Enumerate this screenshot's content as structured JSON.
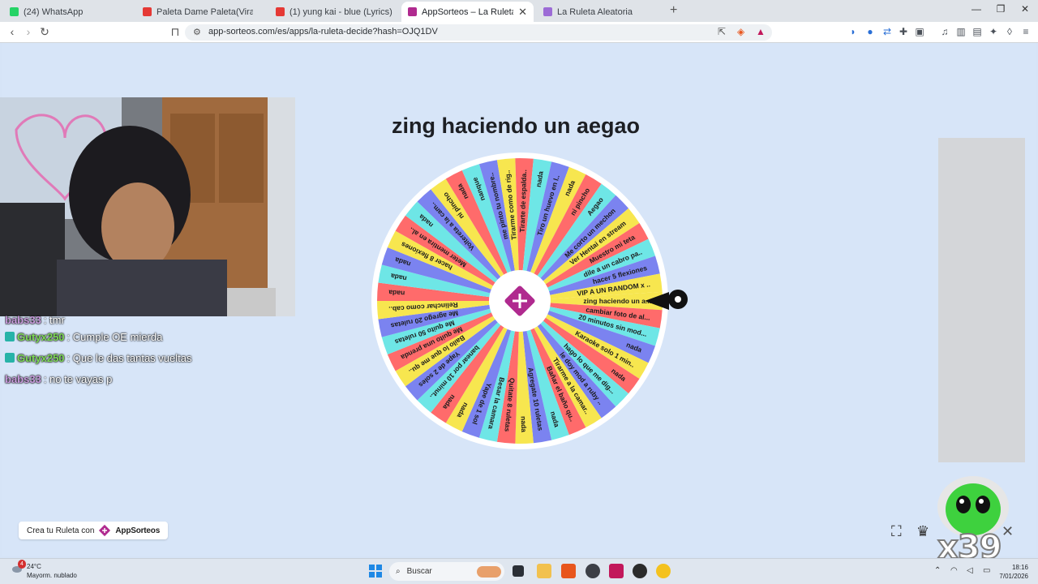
{
  "tabs": [
    {
      "title": "(24) WhatsApp",
      "fav_color": "#25d366"
    },
    {
      "title": "Paleta Dame Paleta(Viral TikTok)",
      "fav_color": "#e53935"
    },
    {
      "title": "(1) yung kai - blue (Lyrics) - YouTube",
      "fav_color": "#e53935"
    },
    {
      "title": "AppSorteos – La Ruleta de la Su",
      "fav_color": "#b02a8f",
      "close": "✕"
    },
    {
      "title": "La Ruleta Aleatoria",
      "fav_color": "#9c6bd6"
    }
  ],
  "new_tab": "+",
  "window_controls": [
    "—",
    "❐",
    "✕"
  ],
  "address": {
    "url": "app-sorteos.com/es/apps/la-ruleta-decide?hash=OJQ1DV"
  },
  "wheel": {
    "title": "zing haciendo un aegao",
    "segment_colors": [
      "#f7e64f",
      "#ff6b6b",
      "#6ee6e6",
      "#7b83f0",
      "#f7e64f",
      "#ff6b6b",
      "#6ee6e6",
      "#7b83f0"
    ],
    "segments": [
      "zing haciendo un a...",
      "cambiar foto de al...",
      "20 minutos sin mod...",
      "nada",
      "Karaoke solo 1 min..",
      "nada",
      "hago lo que me dig...",
      "le doy mod a ruby ..",
      "Tirarme a la camar..",
      "Bañar el baño qu..",
      "nada",
      "Agregate 10 ruletas",
      "nada",
      "Quitate 8 ruletas",
      "Besar la camara",
      "Yape de 1 sol",
      "nada",
      "nada",
      "banear por 10 minut..",
      "Yape de 2 soles",
      "Bailo lo que me qu..",
      "Me quito una prenda",
      "Me quito 50 ruletas",
      "Me agrego 20 ruletas",
      "Relinchar como cab..",
      "nada",
      "nada",
      "nada",
      "hacer 8 flexiones",
      "Meter mentira en al..",
      "nada",
      "Voltereta a la cam..",
      "ni pincho",
      "nada",
      "nanque",
      "me pinto tu nombre..",
      "Tirarme como de rig..",
      "Tirarte de espalda..",
      "nada",
      "Tiro un huevo en l..",
      "nada",
      "ni pincho",
      "Aegao",
      "Me corto un mechon",
      "Ver Hentai en stream",
      "Muestro mi teta",
      "dile a un cabro pa..",
      "hacer 5 flexiones",
      "VIP A UN RANDOM x .."
    ]
  },
  "crea": {
    "label": "Crea tu Ruleta con",
    "brand": "AppSorteos"
  },
  "chat": [
    {
      "user": "babs33",
      "msg": ": tmr",
      "color": "#c89bdc"
    },
    {
      "user": "Gutyx250",
      "msg": ": Cumple OE mierda",
      "color": "#7ed957",
      "badge": true
    },
    {
      "user": "Gutyx250",
      "msg": ": Que le das tantas vueltas",
      "color": "#7ed957",
      "badge": true
    },
    {
      "user": "babs33",
      "msg": ": no te vayas p",
      "color": "#c89bdc"
    }
  ],
  "overlay_count": "x39",
  "taskbar": {
    "weather_temp": "24°C",
    "weather_desc": "Mayorm. nublado",
    "weather_alert": "4",
    "search_placeholder": "Buscar",
    "time": "18:16",
    "date": "7/01/2026"
  }
}
